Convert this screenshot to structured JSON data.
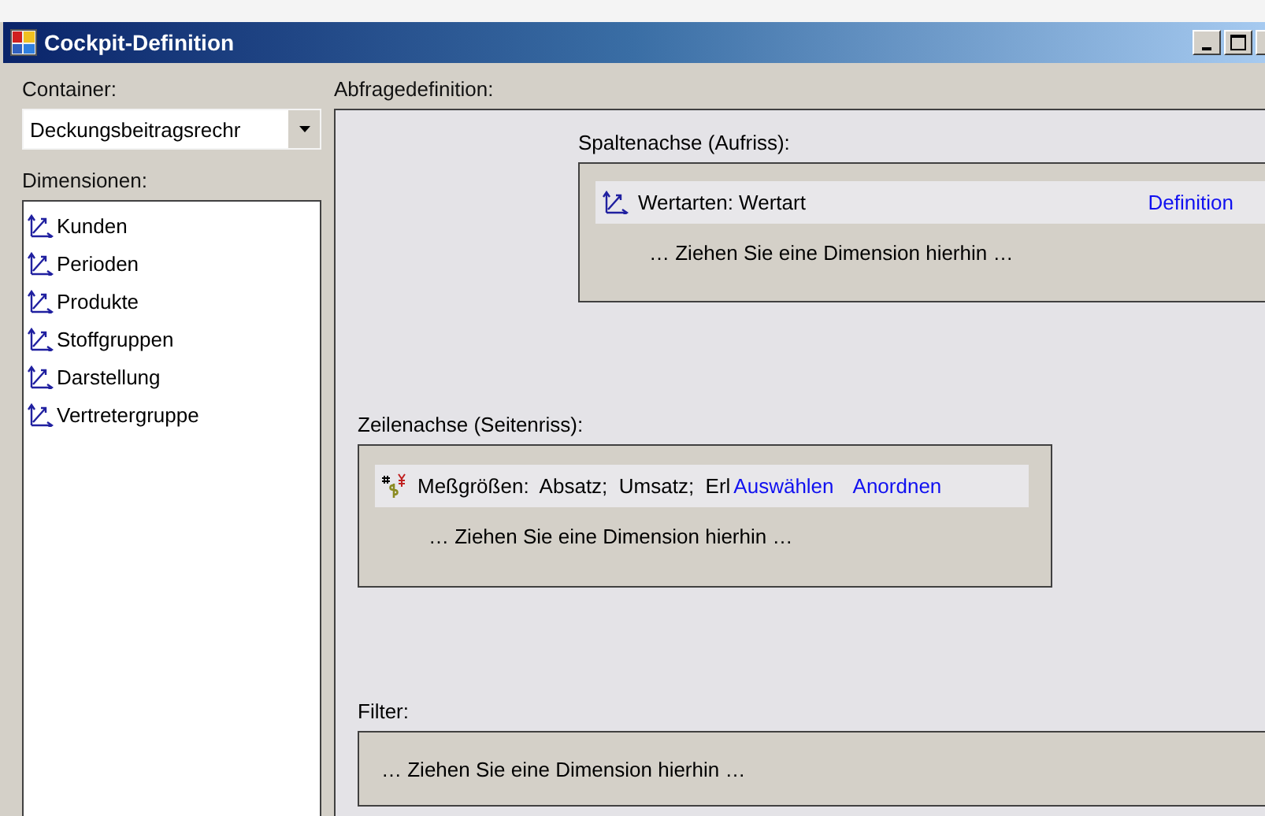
{
  "window": {
    "title": "Cockpit-Definition"
  },
  "container": {
    "label": "Container:",
    "value": "Deckungsbeitragsrechr"
  },
  "dimensions": {
    "label": "Dimensionen:",
    "items": [
      {
        "label": "Kunden"
      },
      {
        "label": "Perioden"
      },
      {
        "label": "Produkte"
      },
      {
        "label": "Stoffgruppen"
      },
      {
        "label": "Darstellung"
      },
      {
        "label": "Vertretergruppe"
      }
    ]
  },
  "query": {
    "label": "Abfragedefinition:",
    "column_axis": {
      "label": "Spaltenachse (Aufriss):",
      "entries": [
        {
          "kind": "dimension",
          "text": "Wertarten: Wertart",
          "links": [
            "Definition"
          ]
        }
      ],
      "hint": "… Ziehen Sie eine Dimension hierhin …"
    },
    "row_axis": {
      "label": "Zeilenachse (Seitenriss):",
      "entries": [
        {
          "kind": "measures",
          "text": "Meßgrößen:  Absatz;  Umsatz;  Erl",
          "links": [
            "Auswählen",
            "Anordnen"
          ]
        }
      ],
      "hint": "… Ziehen Sie eine Dimension hierhin …"
    },
    "filter": {
      "label": "Filter:",
      "hint": "… Ziehen Sie eine Dimension hierhin …"
    }
  }
}
